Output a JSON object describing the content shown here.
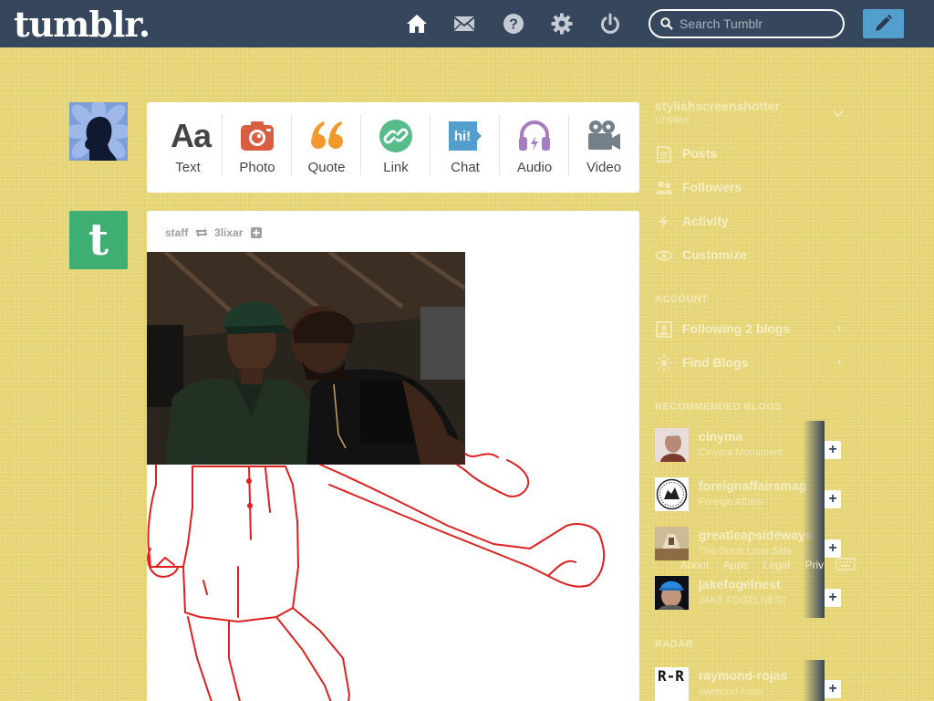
{
  "header": {
    "logo": "tumblr.",
    "nav": [
      {
        "icon": "home-icon"
      },
      {
        "icon": "mail-icon"
      },
      {
        "icon": "help-icon"
      },
      {
        "icon": "gear-icon"
      },
      {
        "icon": "power-icon"
      }
    ],
    "search_placeholder": "Search Tumblr",
    "compose_icon": "pencil-icon"
  },
  "post_types": [
    {
      "label": "Text",
      "icon": "text-icon",
      "color": "#444444"
    },
    {
      "label": "Photo",
      "icon": "camera-icon",
      "color": "#d95e40"
    },
    {
      "label": "Quote",
      "icon": "quote-icon",
      "color": "#f2992e"
    },
    {
      "label": "Link",
      "icon": "link-icon",
      "color": "#56bc8a"
    },
    {
      "label": "Chat",
      "icon": "chat-icon",
      "color": "#529ecc"
    },
    {
      "label": "Audio",
      "icon": "headphones-icon",
      "color": "#a77dc2"
    },
    {
      "label": "Video",
      "icon": "video-camera-icon",
      "color": "#748089"
    }
  ],
  "post": {
    "author": "staff",
    "reblog_icon": "reblog-icon",
    "reblogged_from": "3lixar",
    "follow_icon": "plus-icon"
  },
  "sidebar": {
    "blog_name": "stylishscreenshotter",
    "blog_subtitle": "Untitled",
    "items": [
      {
        "label": "Posts",
        "icon": "posts-icon"
      },
      {
        "label": "Followers",
        "icon": "followers-icon"
      },
      {
        "label": "Activity",
        "icon": "activity-icon"
      },
      {
        "label": "Customize",
        "icon": "eye-icon"
      }
    ],
    "account_header": "ACCOUNT",
    "account_items": [
      {
        "label": "Following 2 blogs",
        "icon": "following-icon"
      },
      {
        "label": "Find Blogs",
        "icon": "find-blogs-icon"
      }
    ],
    "recommended_header": "RECOMMENDED BLOGS",
    "recommended": [
      {
        "name": "cinyma",
        "subtitle": "Cinyma Monument"
      },
      {
        "name": "foreignaffairsmag",
        "subtitle": "Foreign Affairs"
      },
      {
        "name": "greatleapsideways",
        "subtitle": "The Great Leap Side"
      },
      {
        "name": "jakefogelnest",
        "subtitle": "JAKE FOGELNEST"
      }
    ],
    "footer_links": [
      "About",
      "Apps",
      "Legal",
      "Priv"
    ],
    "radar_header": "RADAR",
    "radar": [
      {
        "name": "raymond-rojas",
        "subtitle": "raymond-rojas",
        "thumb_text": "R-R"
      }
    ]
  }
}
